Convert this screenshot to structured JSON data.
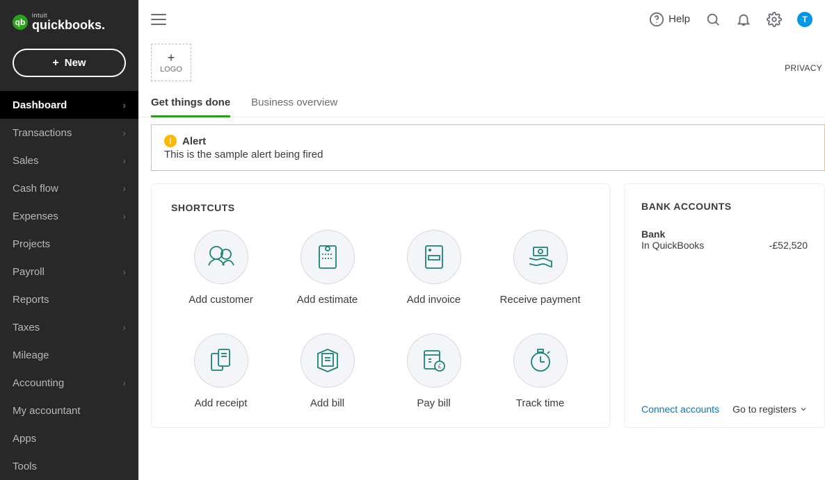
{
  "brand": {
    "top": "intuit",
    "main": "quickbooks."
  },
  "new_button": {
    "label": "New"
  },
  "sidebar": {
    "items": [
      {
        "label": "Dashboard",
        "active": true,
        "chevron": true
      },
      {
        "label": "Transactions",
        "active": false,
        "chevron": true
      },
      {
        "label": "Sales",
        "active": false,
        "chevron": true
      },
      {
        "label": "Cash flow",
        "active": false,
        "chevron": true
      },
      {
        "label": "Expenses",
        "active": false,
        "chevron": true
      },
      {
        "label": "Projects",
        "active": false,
        "chevron": false
      },
      {
        "label": "Payroll",
        "active": false,
        "chevron": true
      },
      {
        "label": "Reports",
        "active": false,
        "chevron": false
      },
      {
        "label": "Taxes",
        "active": false,
        "chevron": true
      },
      {
        "label": "Mileage",
        "active": false,
        "chevron": false
      },
      {
        "label": "Accounting",
        "active": false,
        "chevron": true
      },
      {
        "label": "My accountant",
        "active": false,
        "chevron": false
      },
      {
        "label": "Apps",
        "active": false,
        "chevron": false
      },
      {
        "label": "Tools",
        "active": false,
        "chevron": false
      }
    ]
  },
  "topbar": {
    "help_label": "Help",
    "avatar_initial": "T"
  },
  "header": {
    "logo_box_label": "LOGO",
    "privacy_label": "PRIVACY"
  },
  "tabs": [
    {
      "label": "Get things done",
      "active": true
    },
    {
      "label": "Business overview",
      "active": false
    }
  ],
  "alert": {
    "title": "Alert",
    "message": "This is the sample alert being fired"
  },
  "shortcuts": {
    "title": "SHORTCUTS",
    "items": [
      {
        "label": "Add customer",
        "icon": "people-icon"
      },
      {
        "label": "Add estimate",
        "icon": "estimate-icon"
      },
      {
        "label": "Add invoice",
        "icon": "invoice-icon"
      },
      {
        "label": "Receive payment",
        "icon": "payment-icon"
      },
      {
        "label": "Add receipt",
        "icon": "receipt-icon"
      },
      {
        "label": "Add bill",
        "icon": "bill-icon"
      },
      {
        "label": "Pay bill",
        "icon": "paybill-icon"
      },
      {
        "label": "Track time",
        "icon": "clock-icon"
      }
    ]
  },
  "bank": {
    "title": "BANK ACCOUNTS",
    "account_name": "Bank",
    "sub_label": "In QuickBooks",
    "balance": "-£52,520",
    "connect_label": "Connect accounts",
    "registers_label": "Go to registers"
  }
}
